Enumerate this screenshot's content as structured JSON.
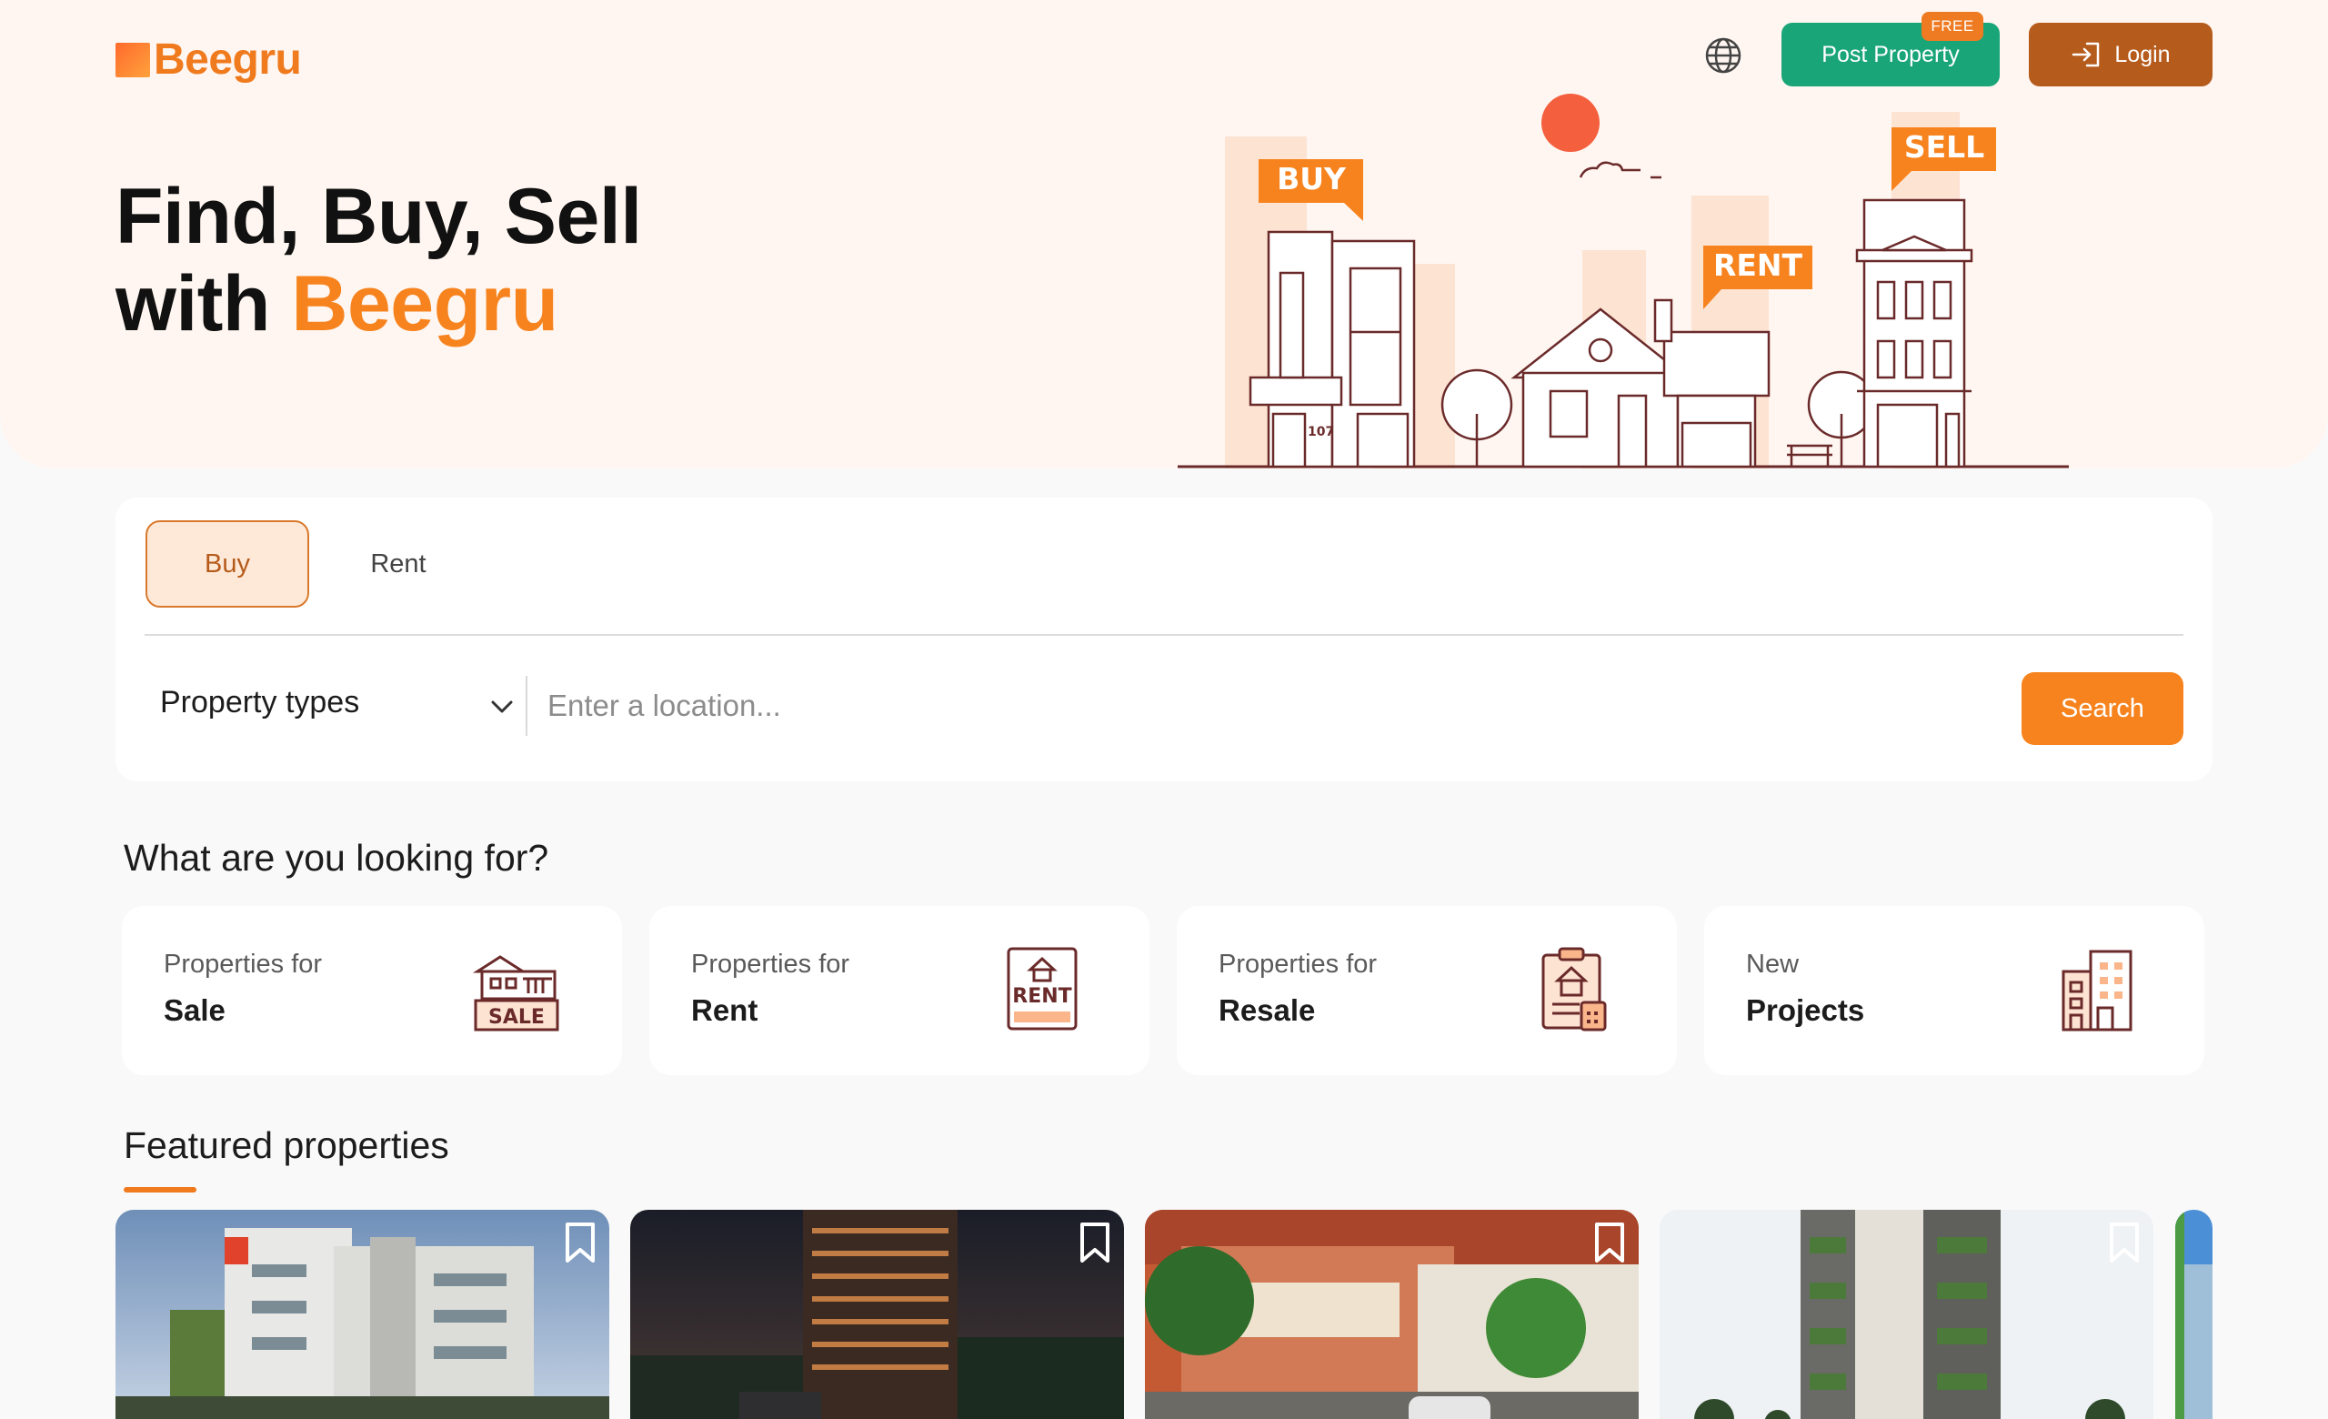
{
  "header": {
    "logo_text": "Beegru",
    "post_property_label": "Post Property",
    "free_badge": "FREE",
    "login_label": "Login",
    "globe_icon": "globe-icon"
  },
  "hero": {
    "title_line1": "Find, Buy, Sell",
    "title_line2_prefix": "with ",
    "title_line2_accent": "Beegru",
    "tags": {
      "buy": "BUY",
      "rent": "RENT",
      "sell": "SELL"
    },
    "house_number": "107"
  },
  "search": {
    "tabs": [
      {
        "label": "Buy",
        "active": true
      },
      {
        "label": "Rent",
        "active": false
      }
    ],
    "property_types_label": "Property types",
    "location_placeholder": "Enter a location...",
    "search_button": "Search"
  },
  "categories_title": "What are you looking for?",
  "categories": [
    {
      "line1": "Properties for",
      "line2": "Sale",
      "icon": "sale-building-icon",
      "icon_text": "SALE"
    },
    {
      "line1": "Properties for",
      "line2": "Rent",
      "icon": "rent-sign-icon",
      "icon_text": "RENT"
    },
    {
      "line1": "Properties for",
      "line2": "Resale",
      "icon": "resale-document-icon"
    },
    {
      "line1": "New",
      "line2": "Projects",
      "icon": "apartment-icon"
    }
  ],
  "featured_title": "Featured properties",
  "colors": {
    "brand_orange": "#f7831e",
    "login_brown": "#b55b1b",
    "post_green": "#1aa579",
    "hero_bg": "#fff6f1",
    "illustration_line": "#6b2a2a"
  }
}
